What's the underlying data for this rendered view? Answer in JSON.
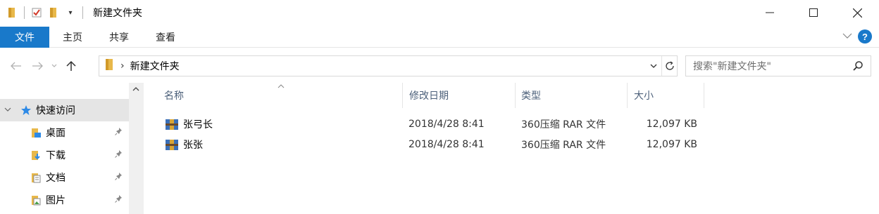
{
  "window": {
    "title": "新建文件夹",
    "controls": {
      "minimize": "—",
      "maximize": "☐",
      "close": "✕"
    }
  },
  "ribbon": {
    "tabs": [
      "文件",
      "主页",
      "共享",
      "查看"
    ],
    "help": "?",
    "accent": "#1979ca"
  },
  "address": {
    "crumb": "新建文件夹",
    "search_placeholder": "搜索\"新建文件夹\""
  },
  "nav": {
    "quick_access": "快速访问",
    "items": [
      {
        "label": "桌面"
      },
      {
        "label": "下载"
      },
      {
        "label": "文档"
      },
      {
        "label": "图片"
      }
    ]
  },
  "list": {
    "columns": {
      "name": "名称",
      "modified": "修改日期",
      "type": "类型",
      "size": "大小"
    },
    "rows": [
      {
        "name": "张弓长",
        "modified": "2018/4/28 8:41",
        "type": "360压缩 RAR 文件",
        "size": "12,097 KB"
      },
      {
        "name": "张张",
        "modified": "2018/4/28 8:41",
        "type": "360压缩 RAR 文件",
        "size": "12,097 KB"
      }
    ]
  }
}
